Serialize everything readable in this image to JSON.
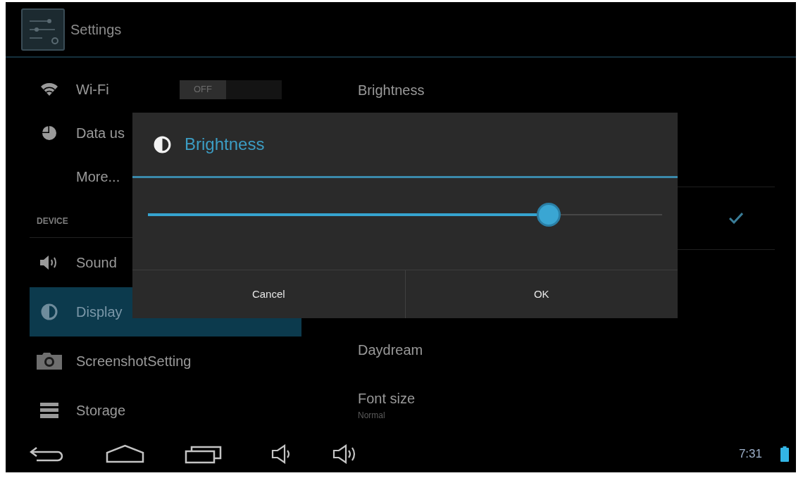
{
  "action_bar": {
    "title": "Settings"
  },
  "sidebar": {
    "items": [
      {
        "kind": "item",
        "label": "Wi-Fi",
        "selected": false,
        "toggle": {
          "label": "OFF",
          "on": false
        }
      },
      {
        "kind": "item",
        "label": "Data us",
        "selected": false
      },
      {
        "kind": "item",
        "label": "More...",
        "selected": false
      },
      {
        "kind": "header",
        "label": "DEVICE"
      },
      {
        "kind": "item",
        "label": "Sound",
        "selected": false
      },
      {
        "kind": "item",
        "label": "Display",
        "selected": true
      },
      {
        "kind": "item",
        "label": "ScreenshotSetting",
        "selected": false
      },
      {
        "kind": "item",
        "label": "Storage",
        "selected": false
      }
    ]
  },
  "display_settings": [
    {
      "kind": "title",
      "title": "Brightness"
    },
    {
      "kind": "checkbox",
      "checked": true
    },
    {
      "kind": "title",
      "title": "Daydream"
    },
    {
      "kind": "title",
      "title": "Font size",
      "summary": "Normal"
    }
  ],
  "dialog": {
    "title": "Brightness",
    "slider": {
      "level": 0.78
    },
    "buttons": [
      "Cancel",
      "OK"
    ]
  },
  "nav_bar": {
    "time": "7:31"
  }
}
